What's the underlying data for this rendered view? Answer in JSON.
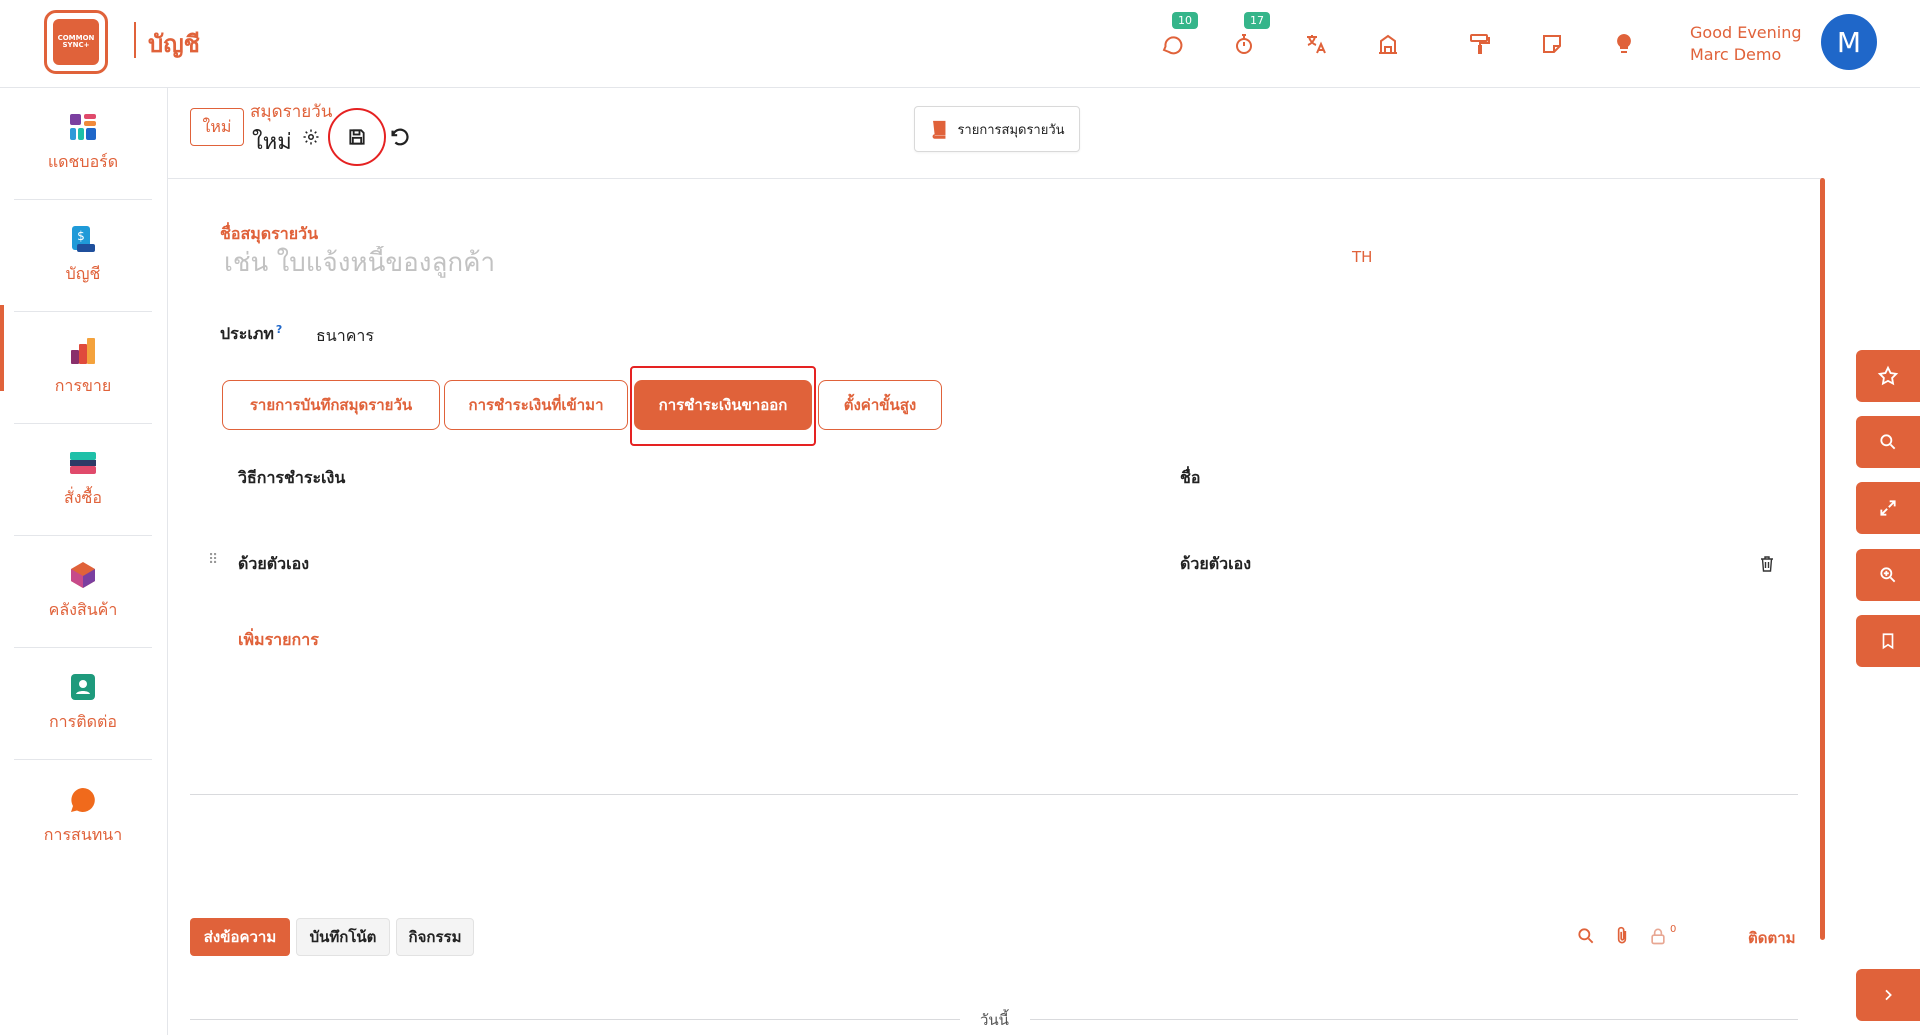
{
  "header": {
    "logo_text": "COMMON SYNC+",
    "app_title": "บัญชี",
    "messages_badge": "10",
    "activities_badge": "17",
    "greeting_line1": "Good Evening",
    "greeting_line2": "Marc Demo",
    "avatar_initial": "M"
  },
  "sidebar": {
    "items": [
      {
        "label": "แดชบอร์ด",
        "icon": "dashboard-icon"
      },
      {
        "label": "บัญชี",
        "icon": "accounting-icon"
      },
      {
        "label": "การขาย",
        "icon": "sales-icon"
      },
      {
        "label": "สั่งซื้อ",
        "icon": "purchase-icon"
      },
      {
        "label": "คลังสินค้า",
        "icon": "inventory-icon"
      },
      {
        "label": "การติดต่อ",
        "icon": "contacts-icon"
      },
      {
        "label": "การสนทนา",
        "icon": "discuss-icon"
      }
    ]
  },
  "control_panel": {
    "new_label": "ใหม่",
    "breadcrumb_parent": "สมุดรายวัน",
    "breadcrumb_current": "ใหม่",
    "journal_items_label": "รายการสมุดรายวัน"
  },
  "form": {
    "name_label": "ชื่อสมุดรายวัน",
    "name_placeholder": "เช่น ใบแจ้งหนี้ของลูกค้า",
    "lang_code": "TH",
    "type_label": "ประเภท",
    "type_help": "?",
    "type_value": "ธนาคาร",
    "tabs": [
      {
        "label": "รายการบันทึกสมุดรายวัน"
      },
      {
        "label": "การชำระเงินที่เข้ามา"
      },
      {
        "label": "การชำระเงินขาออก"
      },
      {
        "label": "ตั้งค่าขั้นสูง"
      }
    ],
    "active_tab": "การชำระเงินขาออก",
    "table": {
      "columns": [
        "วิธีการชำระเงิน",
        "ชื่อ"
      ],
      "rows": [
        [
          "ด้วยตัวเอง",
          "ด้วยตัวเอง"
        ]
      ],
      "add_line_label": "เพิ่มรายการ"
    }
  },
  "chatter": {
    "send_message": "ส่งข้อความ",
    "log_note": "บันทึกโน้ต",
    "activity": "กิจกรรม",
    "followers_count": "0",
    "follow_label": "ติดตาม",
    "today_label": "วันนี้"
  },
  "colors": {
    "accent": "#e0623a",
    "highlight_ring": "#e52222",
    "badge": "#35b58a",
    "avatar": "#1f67c9"
  }
}
